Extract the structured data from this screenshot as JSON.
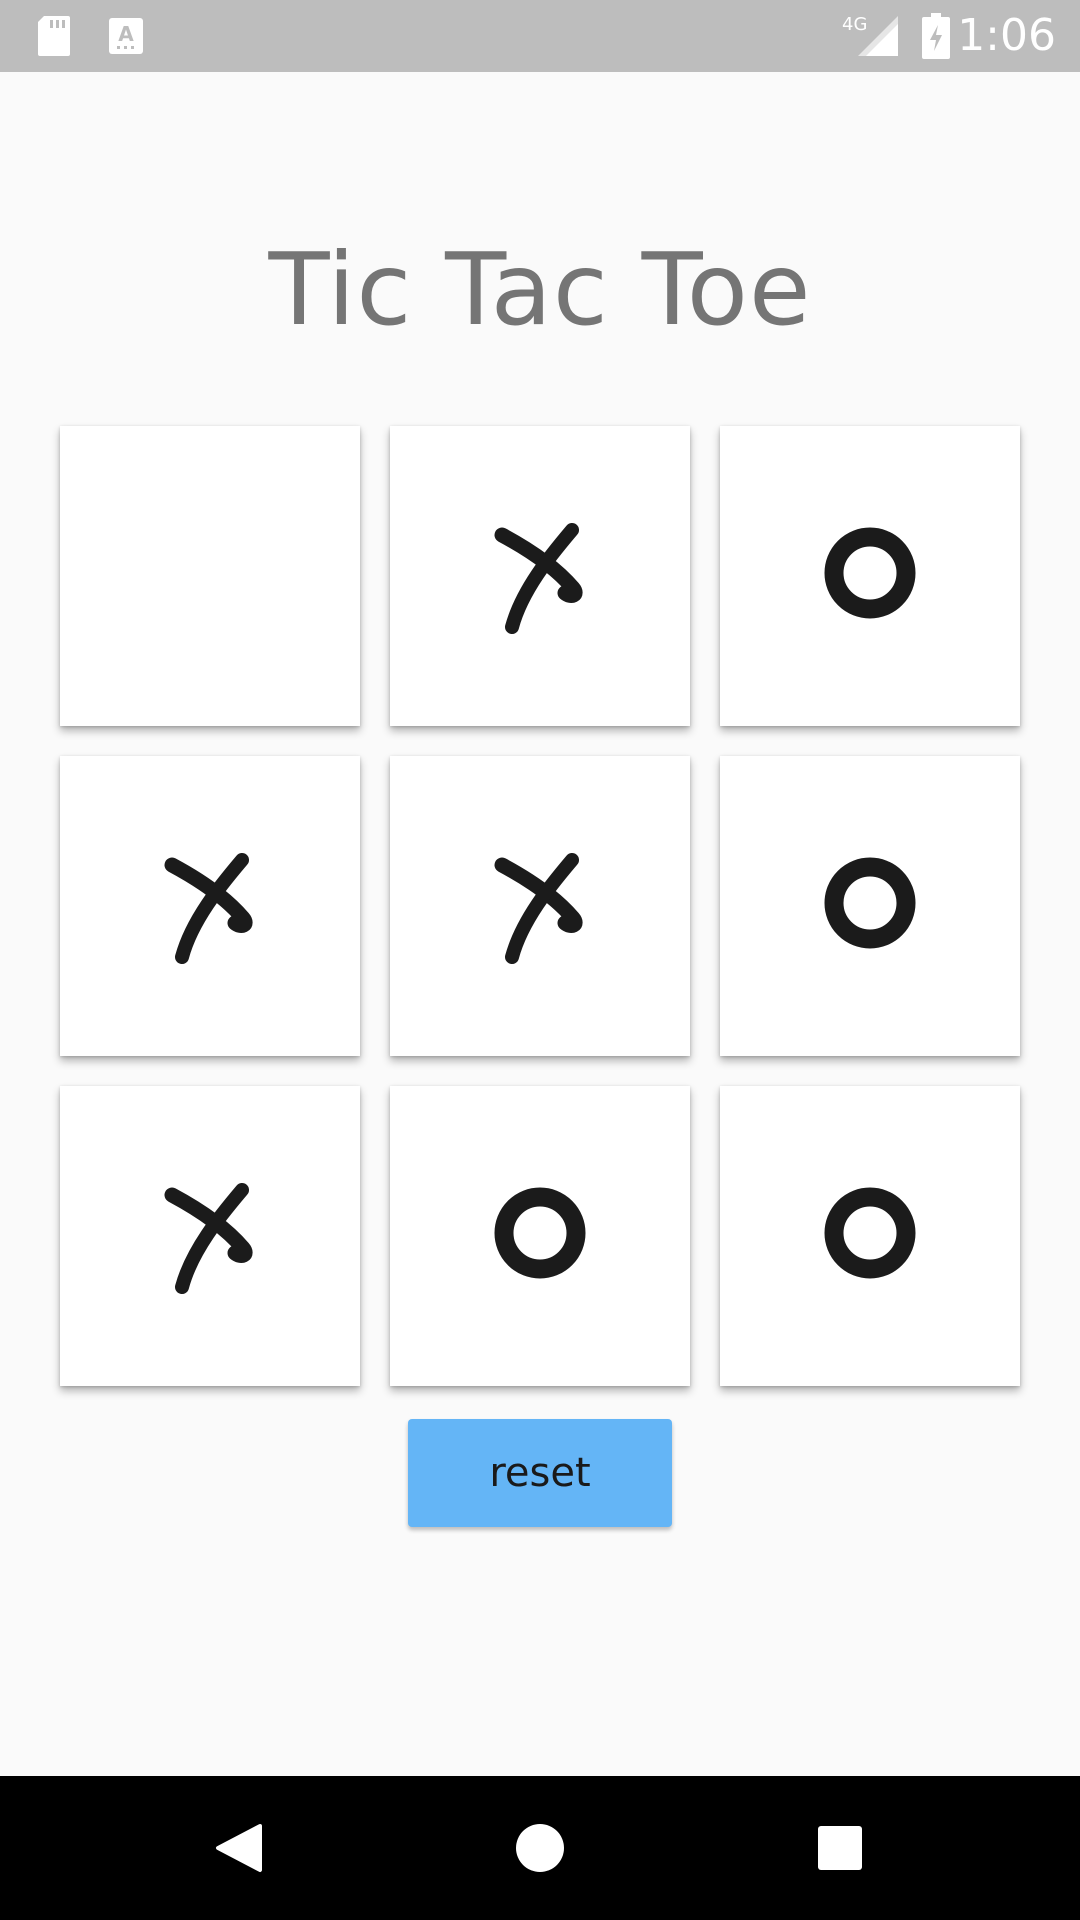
{
  "status_bar": {
    "time": "1:06",
    "network": "4G",
    "icons": [
      "sd-card-icon",
      "text-a-icon",
      "signal-icon",
      "battery-charging-icon"
    ]
  },
  "title": "Tic Tac Toe",
  "board": {
    "cells": [
      "",
      "X",
      "O",
      "X",
      "X",
      "O",
      "X",
      "O",
      "O"
    ]
  },
  "reset_label": "reset",
  "nav_bar": {
    "icons": [
      "back-icon",
      "home-icon",
      "recents-icon"
    ]
  },
  "colors": {
    "background": "#fafafa",
    "status_bar": "#bdbdbd",
    "title": "#757575",
    "button": "#64b5f6",
    "mark": "#1b1b1b",
    "nav_bar": "#000000"
  }
}
